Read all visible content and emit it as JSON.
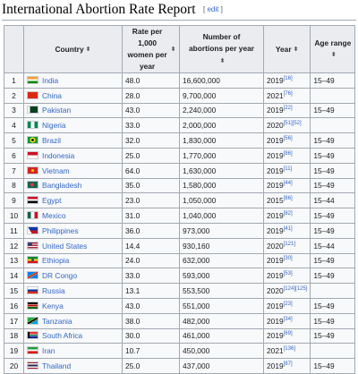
{
  "heading": {
    "title": "International Abortion Rate Report",
    "edit_open": "[",
    "edit_label": "edit",
    "edit_close": "]"
  },
  "table": {
    "headers": {
      "rank": "",
      "country": "Country",
      "rate": "Rate per 1,000 women per year",
      "number": "Number of abortions per year",
      "year": "Year",
      "age": "Age range"
    },
    "rows": [
      {
        "rank": "1",
        "country": "India",
        "flag": "india-flag",
        "rate": "48.0",
        "number": "16,600,000",
        "year": "2019",
        "ref": "[16]",
        "age": "15–49"
      },
      {
        "rank": "2",
        "country": "China",
        "flag": "china-flag",
        "rate": "28.0",
        "number": "9,700,000",
        "year": "2021",
        "ref": "[76]",
        "age": ""
      },
      {
        "rank": "3",
        "country": "Pakistan",
        "flag": "pakistan-flag",
        "rate": "43.0",
        "number": "2,240,000",
        "year": "2019",
        "ref": "[22]",
        "age": "15–49"
      },
      {
        "rank": "4",
        "country": "Nigeria",
        "flag": "nigeria-flag",
        "rate": "33.0",
        "number": "2,000,000",
        "year": "2020",
        "ref": "[51][52]",
        "age": ""
      },
      {
        "rank": "5",
        "country": "Brazil",
        "flag": "brazil-flag",
        "rate": "32.0",
        "number": "1,830,000",
        "year": "2019",
        "ref": "[56]",
        "age": "15–49"
      },
      {
        "rank": "6",
        "country": "Indonesia",
        "flag": "indonesia-flag",
        "rate": "25.0",
        "number": "1,770,000",
        "year": "2019",
        "ref": "[86]",
        "age": "15–49"
      },
      {
        "rank": "7",
        "country": "Vietnam",
        "flag": "vietnam-flag",
        "rate": "64.0",
        "number": "1,630,000",
        "year": "2019",
        "ref": "[11]",
        "age": "15–49"
      },
      {
        "rank": "8",
        "country": "Bangladesh",
        "flag": "bangladesh-flag",
        "rate": "35.0",
        "number": "1,580,000",
        "year": "2019",
        "ref": "[44]",
        "age": "15–49"
      },
      {
        "rank": "9",
        "country": "Egypt",
        "flag": "egypt-flag",
        "rate": "23.0",
        "number": "1,050,000",
        "year": "2015",
        "ref": "[86]",
        "age": "15–44"
      },
      {
        "rank": "10",
        "country": "Mexico",
        "flag": "mexico-flag",
        "rate": "31.0",
        "number": "1,040,000",
        "year": "2019",
        "ref": "[82]",
        "age": "15–49"
      },
      {
        "rank": "11",
        "country": "Philippines",
        "flag": "philippines-flag",
        "rate": "36.0",
        "number": "973,000",
        "year": "2019",
        "ref": "[41]",
        "age": "15–49"
      },
      {
        "rank": "12",
        "country": "United States",
        "flag": "united-states-flag",
        "rate": "14.4",
        "number": "930,160",
        "year": "2020",
        "ref": "[121]",
        "age": "15–44"
      },
      {
        "rank": "13",
        "country": "Ethiopia",
        "flag": "ethiopia-flag",
        "rate": "24.0",
        "number": "632,000",
        "year": "2019",
        "ref": "[30]",
        "age": "15–49"
      },
      {
        "rank": "14",
        "country": "DR Congo",
        "flag": "dr-congo-flag",
        "rate": "33.0",
        "number": "593,000",
        "year": "2019",
        "ref": "[53]",
        "age": "15–49"
      },
      {
        "rank": "15",
        "country": "Russia",
        "flag": "russia-flag",
        "rate": "13.1",
        "number": "553,500",
        "year": "2020",
        "ref": "[124][125]",
        "age": ""
      },
      {
        "rank": "16",
        "country": "Kenya",
        "flag": "kenya-flag",
        "rate": "43.0",
        "number": "551,000",
        "year": "2019",
        "ref": "[23]",
        "age": "15–49"
      },
      {
        "rank": "17",
        "country": "Tanzania",
        "flag": "tanzania-flag",
        "rate": "38.0",
        "number": "482,000",
        "year": "2019",
        "ref": "[34]",
        "age": "15–49"
      },
      {
        "rank": "18",
        "country": "South Africa",
        "flag": "south-africa-flag",
        "rate": "30.0",
        "number": "461,000",
        "year": "2019",
        "ref": "[69]",
        "age": "15–49"
      },
      {
        "rank": "19",
        "country": "Iran",
        "flag": "iran-flag",
        "rate": "10.7",
        "number": "450,000",
        "year": "2021",
        "ref": "[136]",
        "age": ""
      },
      {
        "rank": "20",
        "country": "Thailand",
        "flag": "thailand-flag",
        "rate": "25.0",
        "number": "437,000",
        "year": "2019",
        "ref": "[87]",
        "age": "15–49"
      }
    ]
  },
  "colors": {
    "link": "#3366cc",
    "header_bg": "#eaecf0",
    "cell_bg": "#f8f9fa",
    "border": "#a2a9b1"
  }
}
